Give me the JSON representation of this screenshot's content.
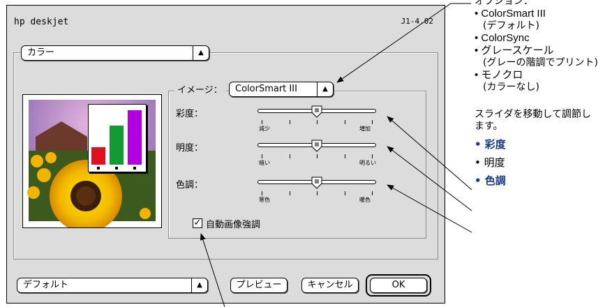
{
  "dialog": {
    "title": "hp deskjet",
    "version": "J1-4.02",
    "panel_select": "カラー",
    "image_label": "イメージ：",
    "image_mode": "ColorSmart III",
    "sliders": [
      {
        "label": "彩度：",
        "min_label": "減少",
        "max_label": "増加",
        "value_fraction": 0.5
      },
      {
        "label": "明度：",
        "min_label": "暗い",
        "max_label": "明るい",
        "value_fraction": 0.5
      },
      {
        "label": "色調：",
        "min_label": "寒色",
        "max_label": "暖色",
        "value_fraction": 0.5
      }
    ],
    "auto_enhance_label": "自動画像強調",
    "auto_enhance_checked": true,
    "preset_select": "デフォルト",
    "preview_button": "プレビュー",
    "cancel_button": "キャンセル",
    "ok_button": "OK",
    "preview_bars": [
      {
        "color": "#e01020",
        "value": 0.32
      },
      {
        "color": "#129a35",
        "value": 0.72
      },
      {
        "color": "#b000e0",
        "value": 1.0
      }
    ]
  },
  "annotations": {
    "options_header": "オプション：",
    "options": [
      {
        "main": "ColorSmart III",
        "sub": "(デフォルト)"
      },
      {
        "main": "ColorSync",
        "sub": ""
      },
      {
        "main": "グレースケール",
        "sub": "(グレーの階調でプリント)"
      },
      {
        "main": "モノクロ",
        "sub": "(カラーなし)"
      }
    ],
    "slider_note": "スライダを移動して調節します。",
    "slider_items": [
      "彩度",
      "明度",
      "色調"
    ]
  },
  "colors": {
    "dialog_bg": "#dcdcdc",
    "annotation_blue": "#1a3a8c"
  }
}
